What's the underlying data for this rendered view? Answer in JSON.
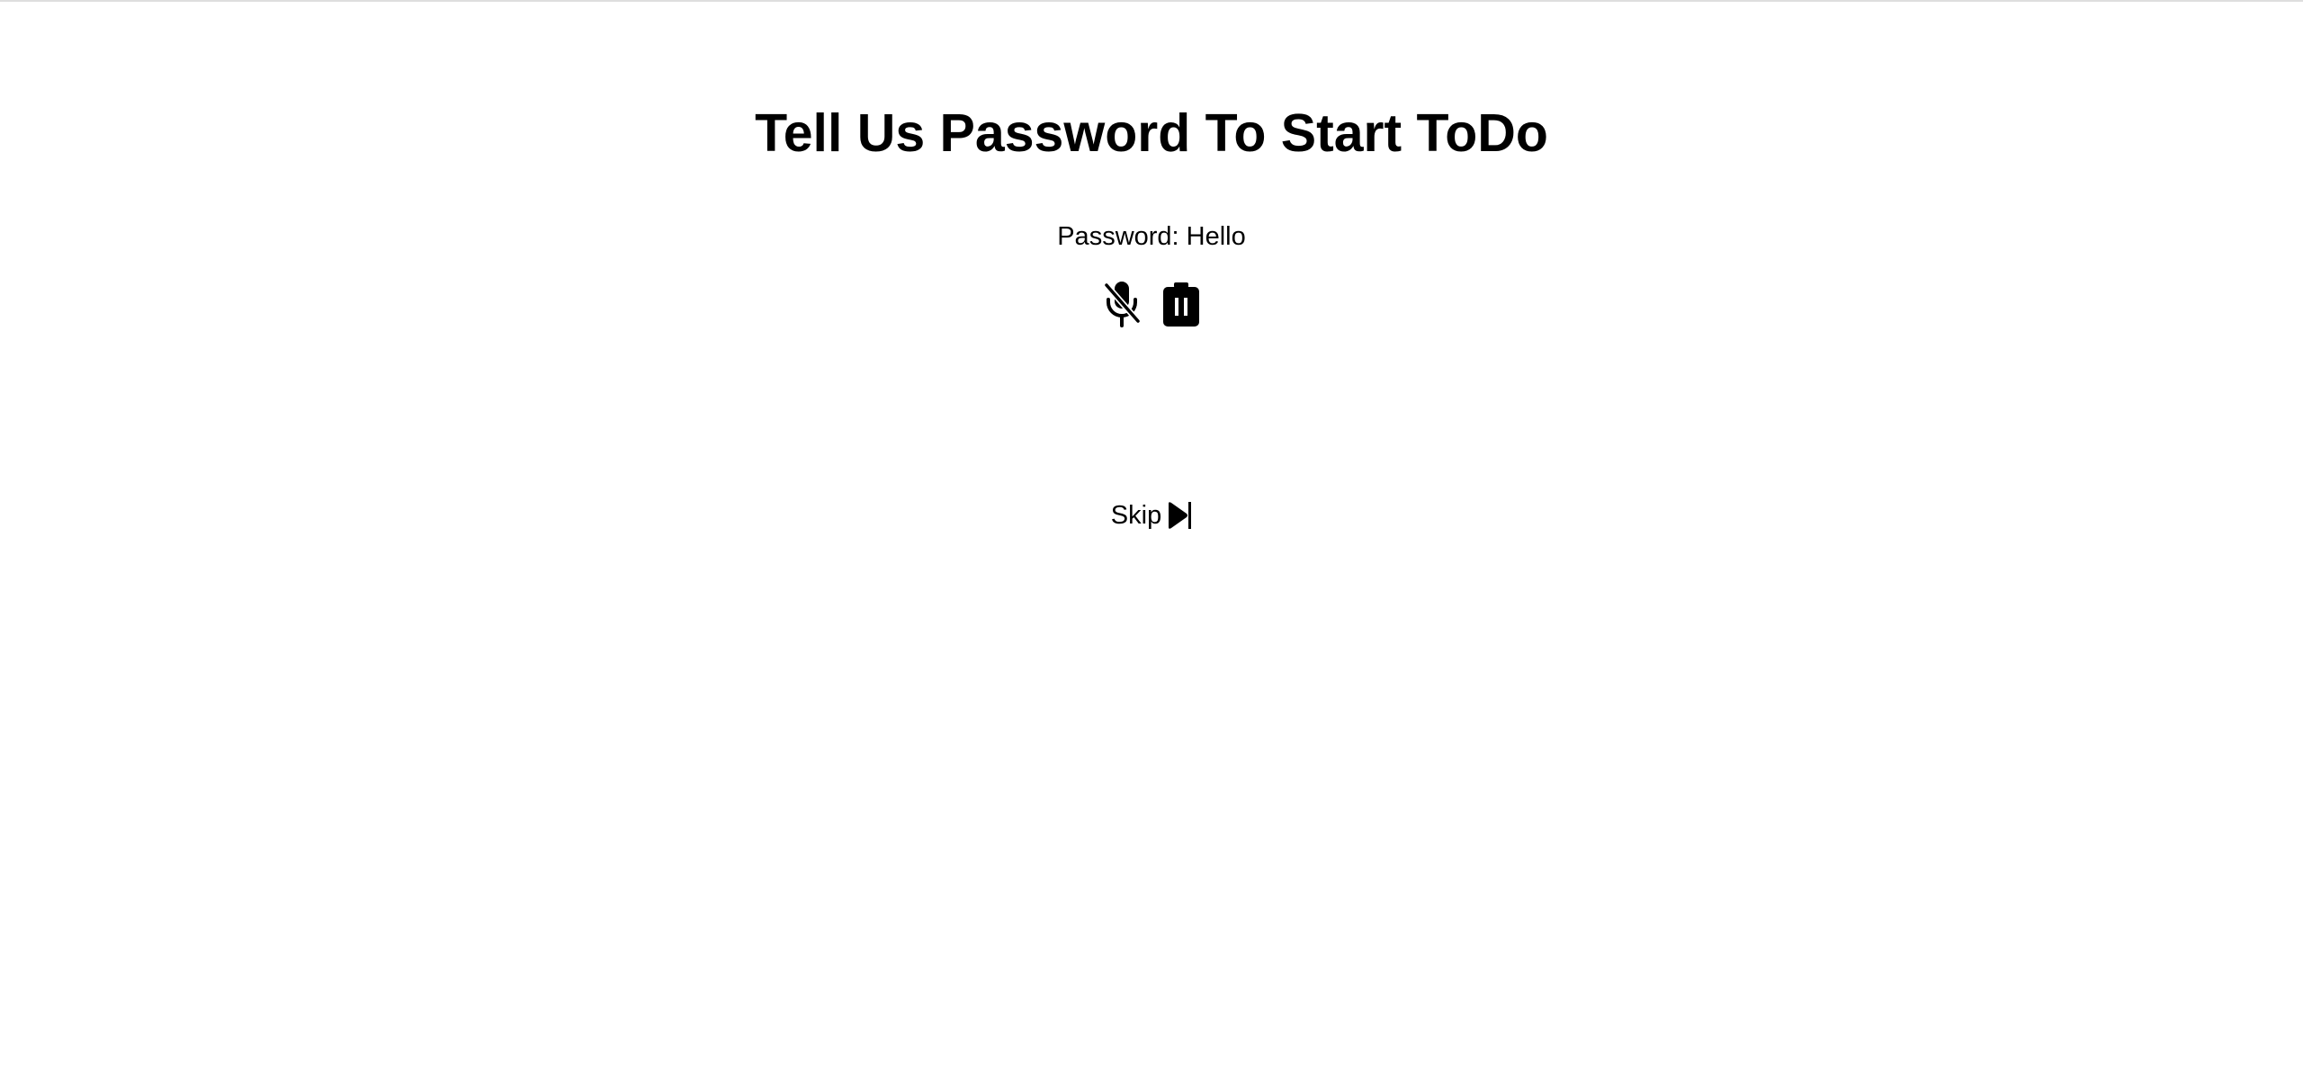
{
  "header": {
    "title": "Tell Us Password To Start ToDo"
  },
  "password": {
    "label": "Password:",
    "value": "Hello"
  },
  "controls": {
    "mic_icon": "microphone-slash-icon",
    "delete_icon": "trash-icon"
  },
  "skip": {
    "label": "Skip",
    "icon": "skip-forward-icon"
  }
}
